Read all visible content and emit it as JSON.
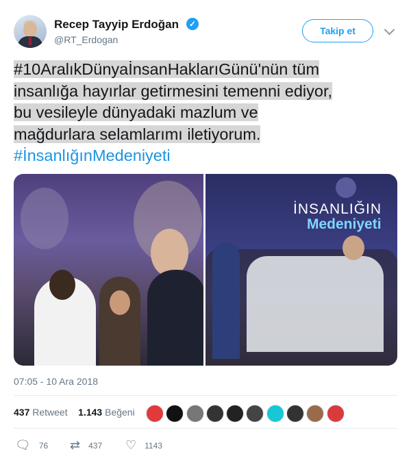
{
  "author": {
    "name": "Recep Tayyip Erdoğan",
    "handle": "@RT_Erdogan"
  },
  "header": {
    "follow_label": "Takip et"
  },
  "tweet": {
    "lines": [
      "#10AralıkDünyaİnsanHaklarıGünü'nün tüm",
      "insanlığa hayırlar getirmesini temenni ediyor,",
      "bu vesileyle dünyadaki mazlum ve",
      "mağdurlara selamlarımı iletiyorum."
    ],
    "hashtag": "#İnsanlığınMedeniyeti"
  },
  "media": {
    "photo2_sign_line1": "İNSANLIĞIN",
    "photo2_sign_line2": "Medeniyeti"
  },
  "timestamp": "07:05 - 10 Ara 2018",
  "stats": {
    "retweets": "437",
    "retweets_label": "Retweet",
    "likes": "1.143",
    "likes_label": "Beğeni"
  },
  "likers_colors": [
    "#e03a3a",
    "#111111",
    "#777777",
    "#333333",
    "#222222",
    "#444444",
    "#17c7d6",
    "#333333",
    "#9a6b4b",
    "#d93a3a"
  ],
  "actions": {
    "replies": "76",
    "retweets": "437",
    "likes": "1143"
  }
}
